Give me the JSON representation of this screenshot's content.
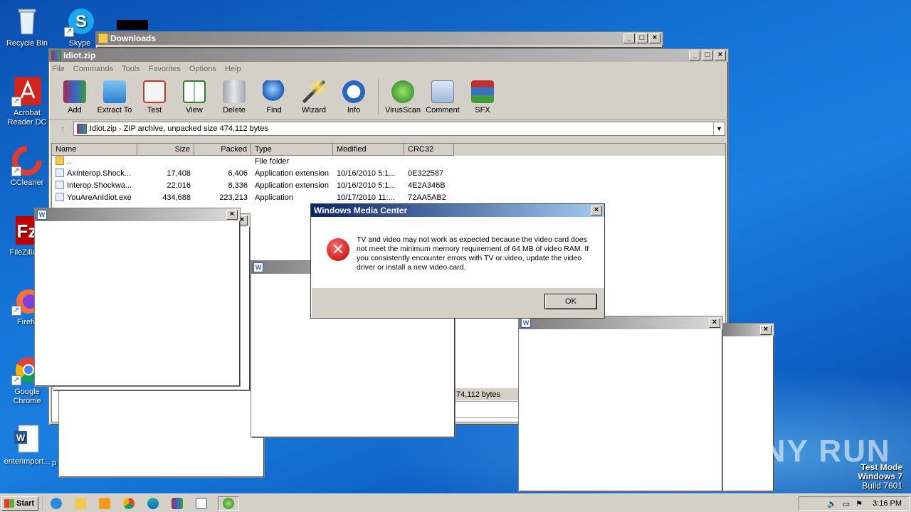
{
  "desktop": {
    "icons": [
      {
        "label": "Recycle Bin",
        "icon": "recycle-bin-icon"
      },
      {
        "label": "Skype",
        "icon": "skype-icon"
      },
      {
        "label": "Acrobat Reader DC",
        "icon": "acrobat-icon"
      },
      {
        "label": "CCleaner",
        "icon": "ccleaner-icon"
      },
      {
        "label": "FileZilla C",
        "icon": "filezilla-icon"
      },
      {
        "label": "Firefo",
        "icon": "firefox-icon"
      },
      {
        "label": "Google Chrome",
        "icon": "chrome-icon"
      },
      {
        "label": "enterimport...",
        "icon": "word-doc-icon"
      },
      {
        "label": "p",
        "icon": "word-doc-icon"
      }
    ]
  },
  "downloads_window": {
    "title": "Downloads"
  },
  "winrar": {
    "title": "Idiot.zip",
    "menu": [
      "File",
      "Commands",
      "Tools",
      "Favorites",
      "Options",
      "Help"
    ],
    "tools": [
      "Add",
      "Extract To",
      "Test",
      "View",
      "Delete",
      "Find",
      "Wizard",
      "Info",
      "VirusScan",
      "Comment",
      "SFX"
    ],
    "address": "Idiot.zip - ZIP archive, unpacked size 474,112 bytes",
    "columns": [
      "Name",
      "Size",
      "Packed",
      "Type",
      "Modified",
      "CRC32"
    ],
    "rows": [
      {
        "name": "..",
        "size": "",
        "packed": "",
        "type": "File folder",
        "modified": "",
        "crc": ""
      },
      {
        "name": "AxInterop.Shock...",
        "size": "17,408",
        "packed": "6,406",
        "type": "Application extension",
        "modified": "10/16/2010 5:1...",
        "crc": "0E322587"
      },
      {
        "name": "Interop.Shockwa...",
        "size": "22,016",
        "packed": "8,336",
        "type": "Application extension",
        "modified": "10/16/2010 5:1...",
        "crc": "4E2A346B"
      },
      {
        "name": "YouAreAnIdiot.exe",
        "size": "434,688",
        "packed": "223,213",
        "type": "Application",
        "modified": "10/17/2010 11:...",
        "crc": "72AA5AB2"
      }
    ],
    "status_fragment": "74,112 bytes"
  },
  "dialog": {
    "title": "Windows Media Center",
    "message": "TV and video may not work as expected because the video card does not meet the minimum memory requirement of 64 MB of video RAM. If you consistently encounter errors with TV or video, update the video driver or install a new video card.",
    "ok_label": "OK"
  },
  "taskbar": {
    "start_label": "Start",
    "time": "3:16 PM"
  },
  "watermark": {
    "line1": "Test Mode",
    "line2": "Windows 7",
    "line3": "Build 7601",
    "brand": "ANY RUN"
  },
  "colors": {
    "desktop_blue": "#1473d6",
    "title_active": "#0a246a",
    "error_red": "#c00000"
  }
}
